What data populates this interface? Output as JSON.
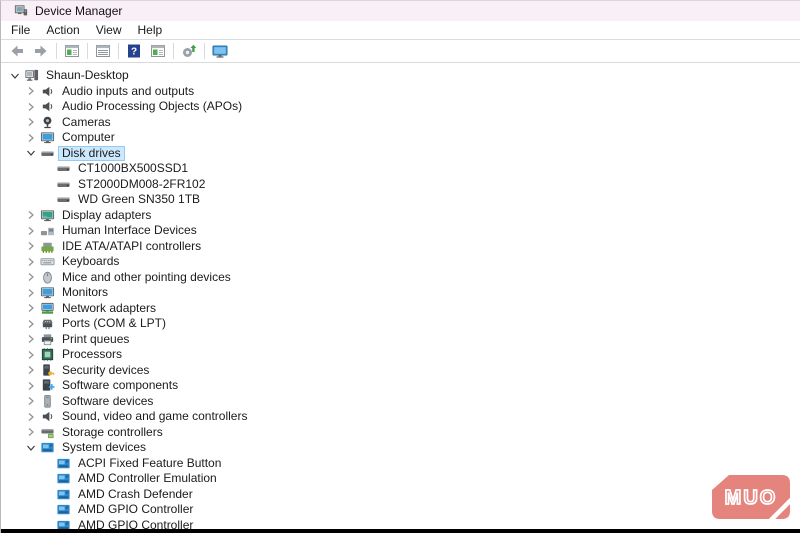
{
  "window": {
    "title": "Device Manager"
  },
  "menu": {
    "items": [
      "File",
      "Action",
      "View",
      "Help"
    ]
  },
  "toolbar": {
    "buttons": [
      {
        "name": "back-button",
        "icon": "back-arrow-icon",
        "divider_after": false
      },
      {
        "name": "forward-button",
        "icon": "forward-arrow-icon",
        "divider_after": true
      },
      {
        "name": "show-console-tree-button",
        "icon": "window-tree-icon",
        "divider_after": true
      },
      {
        "name": "properties-button",
        "icon": "window-list-icon",
        "divider_after": true
      },
      {
        "name": "help-button",
        "icon": "help-icon",
        "divider_after": false
      },
      {
        "name": "action-pane-button",
        "icon": "window-tree-icon",
        "divider_after": true
      },
      {
        "name": "scan-hardware-changes-button",
        "icon": "scan-icon",
        "divider_after": true
      },
      {
        "name": "computer-button",
        "icon": "computer-toolbar-icon",
        "divider_after": false
      }
    ]
  },
  "tree": {
    "items": [
      {
        "label": "Shaun-Desktop",
        "level": 0,
        "state": "expanded",
        "icon": "desktop-pc-icon",
        "selected": false
      },
      {
        "label": "Audio inputs and outputs",
        "level": 1,
        "state": "collapsed",
        "icon": "speaker-icon",
        "selected": false
      },
      {
        "label": "Audio Processing Objects (APOs)",
        "level": 1,
        "state": "collapsed",
        "icon": "speaker-icon",
        "selected": false
      },
      {
        "label": "Cameras",
        "level": 1,
        "state": "collapsed",
        "icon": "camera-icon",
        "selected": false
      },
      {
        "label": "Computer",
        "level": 1,
        "state": "collapsed",
        "icon": "monitor-icon",
        "selected": false
      },
      {
        "label": "Disk drives",
        "level": 1,
        "state": "expanded",
        "icon": "disk-icon",
        "selected": true
      },
      {
        "label": "CT1000BX500SSD1",
        "level": 2,
        "state": "none",
        "icon": "disk-icon",
        "selected": false
      },
      {
        "label": "ST2000DM008-2FR102",
        "level": 2,
        "state": "none",
        "icon": "disk-icon",
        "selected": false
      },
      {
        "label": "WD Green SN350 1TB",
        "level": 2,
        "state": "none",
        "icon": "disk-icon",
        "selected": false
      },
      {
        "label": "Display adapters",
        "level": 1,
        "state": "collapsed",
        "icon": "display-adapter-icon",
        "selected": false
      },
      {
        "label": "Human Interface Devices",
        "level": 1,
        "state": "collapsed",
        "icon": "hid-icon",
        "selected": false
      },
      {
        "label": "IDE ATA/ATAPI controllers",
        "level": 1,
        "state": "collapsed",
        "icon": "ide-controller-icon",
        "selected": false
      },
      {
        "label": "Keyboards",
        "level": 1,
        "state": "collapsed",
        "icon": "keyboard-icon",
        "selected": false
      },
      {
        "label": "Mice and other pointing devices",
        "level": 1,
        "state": "collapsed",
        "icon": "mouse-icon",
        "selected": false
      },
      {
        "label": "Monitors",
        "level": 1,
        "state": "collapsed",
        "icon": "monitor-icon",
        "selected": false
      },
      {
        "label": "Network adapters",
        "level": 1,
        "state": "collapsed",
        "icon": "network-adapter-icon",
        "selected": false
      },
      {
        "label": "Ports (COM & LPT)",
        "level": 1,
        "state": "collapsed",
        "icon": "serial-port-icon",
        "selected": false
      },
      {
        "label": "Print queues",
        "level": 1,
        "state": "collapsed",
        "icon": "printer-icon",
        "selected": false
      },
      {
        "label": "Processors",
        "level": 1,
        "state": "collapsed",
        "icon": "processor-icon",
        "selected": false
      },
      {
        "label": "Security devices",
        "level": 1,
        "state": "collapsed",
        "icon": "security-device-icon",
        "selected": false
      },
      {
        "label": "Software components",
        "level": 1,
        "state": "collapsed",
        "icon": "software-component-icon",
        "selected": false
      },
      {
        "label": "Software devices",
        "level": 1,
        "state": "collapsed",
        "icon": "software-device-icon",
        "selected": false
      },
      {
        "label": "Sound, video and game controllers",
        "level": 1,
        "state": "collapsed",
        "icon": "speaker-icon",
        "selected": false
      },
      {
        "label": "Storage controllers",
        "level": 1,
        "state": "collapsed",
        "icon": "storage-controller-icon",
        "selected": false
      },
      {
        "label": "System devices",
        "level": 1,
        "state": "expanded",
        "icon": "system-device-icon",
        "selected": false
      },
      {
        "label": "ACPI Fixed Feature Button",
        "level": 2,
        "state": "none",
        "icon": "system-device-icon",
        "selected": false
      },
      {
        "label": "AMD Controller Emulation",
        "level": 2,
        "state": "none",
        "icon": "system-device-icon",
        "selected": false
      },
      {
        "label": "AMD Crash Defender",
        "level": 2,
        "state": "none",
        "icon": "system-device-icon",
        "selected": false
      },
      {
        "label": "AMD GPIO Controller",
        "level": 2,
        "state": "none",
        "icon": "system-device-icon",
        "selected": false
      },
      {
        "label": "AMD GPIO Controller",
        "level": 2,
        "state": "none",
        "icon": "system-device-icon",
        "selected": false
      }
    ]
  },
  "selection": {
    "background": "#cce8ff",
    "border": "#95cbf0"
  },
  "watermark": {
    "text": "MUO",
    "color": "#e5837d"
  }
}
